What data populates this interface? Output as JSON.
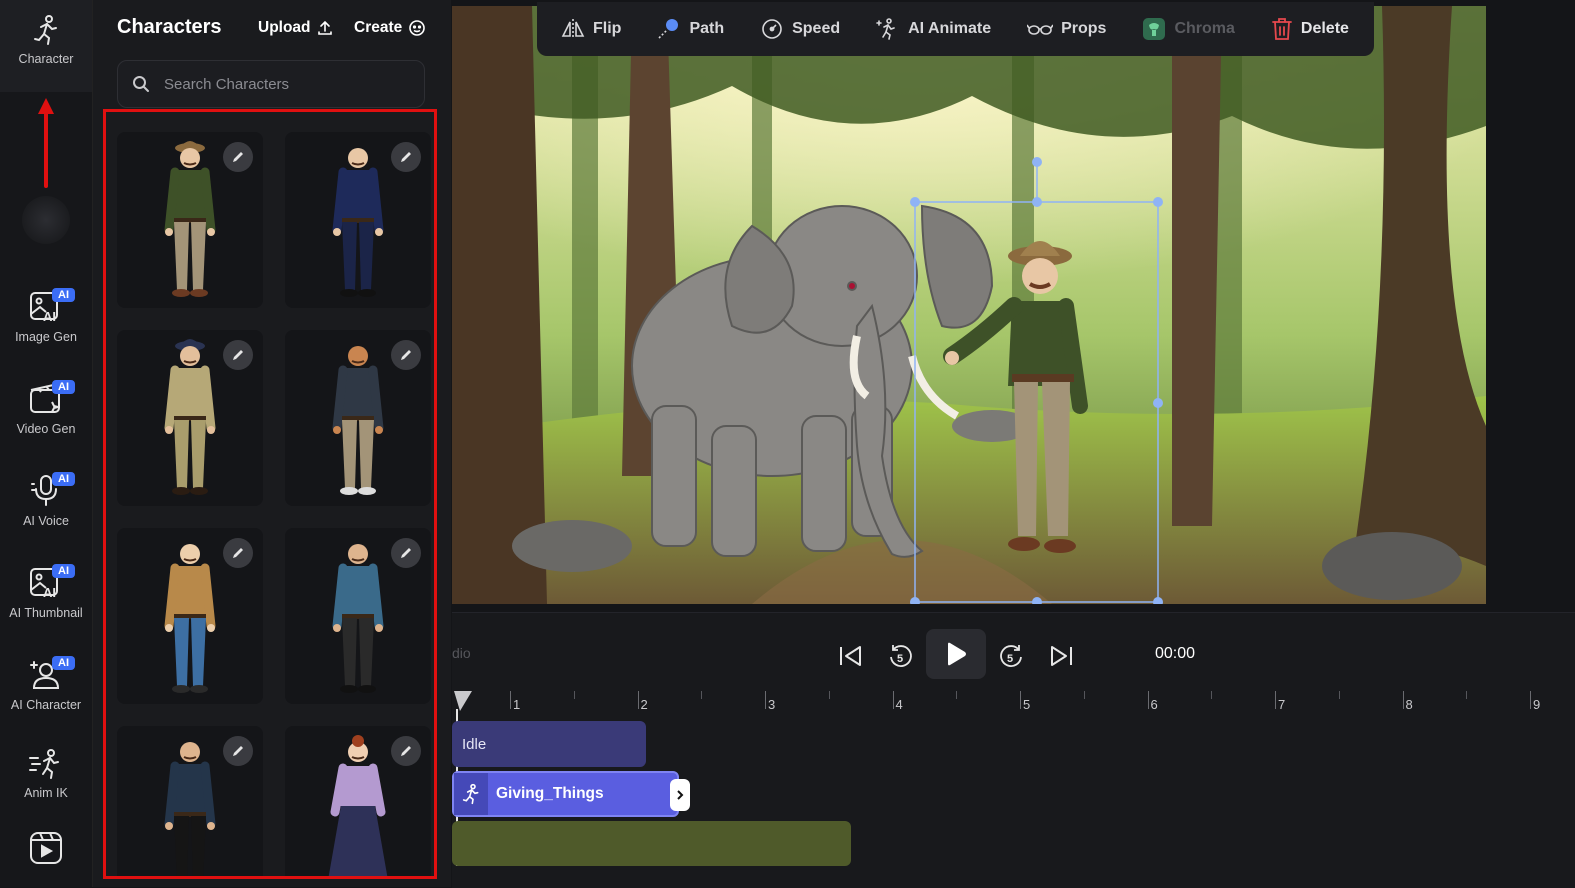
{
  "rail": {
    "items": [
      {
        "label": "Character",
        "icon": "running-person-icon",
        "ai": false
      },
      {
        "label": "Image Gen",
        "icon": "image-ai-icon",
        "ai": true
      },
      {
        "label": "Video Gen",
        "icon": "video-clapper-icon",
        "ai": true
      },
      {
        "label": "AI Voice",
        "icon": "microphone-icon",
        "ai": true
      },
      {
        "label": "AI Thumbnail",
        "icon": "image-ai-icon",
        "ai": true
      },
      {
        "label": "AI Character",
        "icon": "person-sparkle-icon",
        "ai": true
      },
      {
        "label": "Anim IK",
        "icon": "motion-person-icon",
        "ai": false
      }
    ],
    "ai_badge": "AI",
    "annotation_arrow_color": "#e01010"
  },
  "panel": {
    "title": "Characters",
    "upload_label": "Upload",
    "create_label": "Create",
    "search_placeholder": "Search Characters",
    "highlight_color": "#e01010",
    "characters": [
      {
        "name": "ranger",
        "hat": "#8b6a3e",
        "shirt": "#3e5128",
        "pants": "#a39478",
        "skin": "#e8c7a5",
        "shoes": "#6b3a22"
      },
      {
        "name": "police-officer",
        "hat": null,
        "shirt": "#1e2a5a",
        "pants": "#1b2448",
        "skin": "#e8c7a5",
        "shoes": "#111"
      },
      {
        "name": "khaki-officer",
        "hat": "#2a3352",
        "shirt": "#b6a877",
        "pants": "#a99d6c",
        "skin": "#e3bf9b",
        "shoes": "#2a1c12"
      },
      {
        "name": "casual-man-orange",
        "hat": null,
        "shirt": "#2f3845",
        "pants": "#a39478",
        "skin": "#c98550",
        "shoes": "#ddd"
      },
      {
        "name": "plaid-blazer-man",
        "hat": null,
        "shirt": "#b8894a",
        "pants": "#3d6fa3",
        "skin": "#edcfac",
        "shoes": "#2a2a2a"
      },
      {
        "name": "blue-shirt-man",
        "hat": null,
        "shirt": "#3a6a8a",
        "pants": "#2a2a2a",
        "skin": "#deb48e",
        "shoes": "#111"
      },
      {
        "name": "dark-shirt-man",
        "hat": null,
        "shirt": "#24354a",
        "pants": "#151515",
        "skin": "#deb48e",
        "shoes": "#111"
      },
      {
        "name": "woman-lavender",
        "hat": null,
        "shirt": "#b49ad0",
        "pants": "#2e3158",
        "skin": "#f0cfb2",
        "shoes": "#222"
      }
    ]
  },
  "toolbar": {
    "items": [
      {
        "label": "Flip",
        "icon": "flip-icon",
        "state": "normal"
      },
      {
        "label": "Path",
        "icon": "path-icon",
        "state": "normal"
      },
      {
        "label": "Speed",
        "icon": "speed-icon",
        "state": "normal"
      },
      {
        "label": "AI Animate",
        "icon": "ai-animate-icon",
        "state": "normal"
      },
      {
        "label": "Props",
        "icon": "glasses-icon",
        "state": "normal"
      },
      {
        "label": "Chroma",
        "icon": "chroma-icon",
        "state": "disabled"
      },
      {
        "label": "Delete",
        "icon": "trash-icon",
        "state": "danger"
      }
    ]
  },
  "timeline": {
    "studio_label": "dio",
    "timecode": "00:00",
    "ruler_ticks": [
      "1",
      "2",
      "3",
      "4",
      "5",
      "6",
      "7",
      "8",
      "9"
    ],
    "tracks": [
      {
        "label": "Idle",
        "color": "#3a3a78"
      },
      {
        "label": "Giving_Things",
        "color": "#5a5ee0"
      },
      {
        "label": "",
        "color": "#4f5a2a"
      }
    ]
  },
  "colors": {
    "accent": "#3b6df5",
    "danger": "#e5484d",
    "selection": "#8fb3f5"
  }
}
